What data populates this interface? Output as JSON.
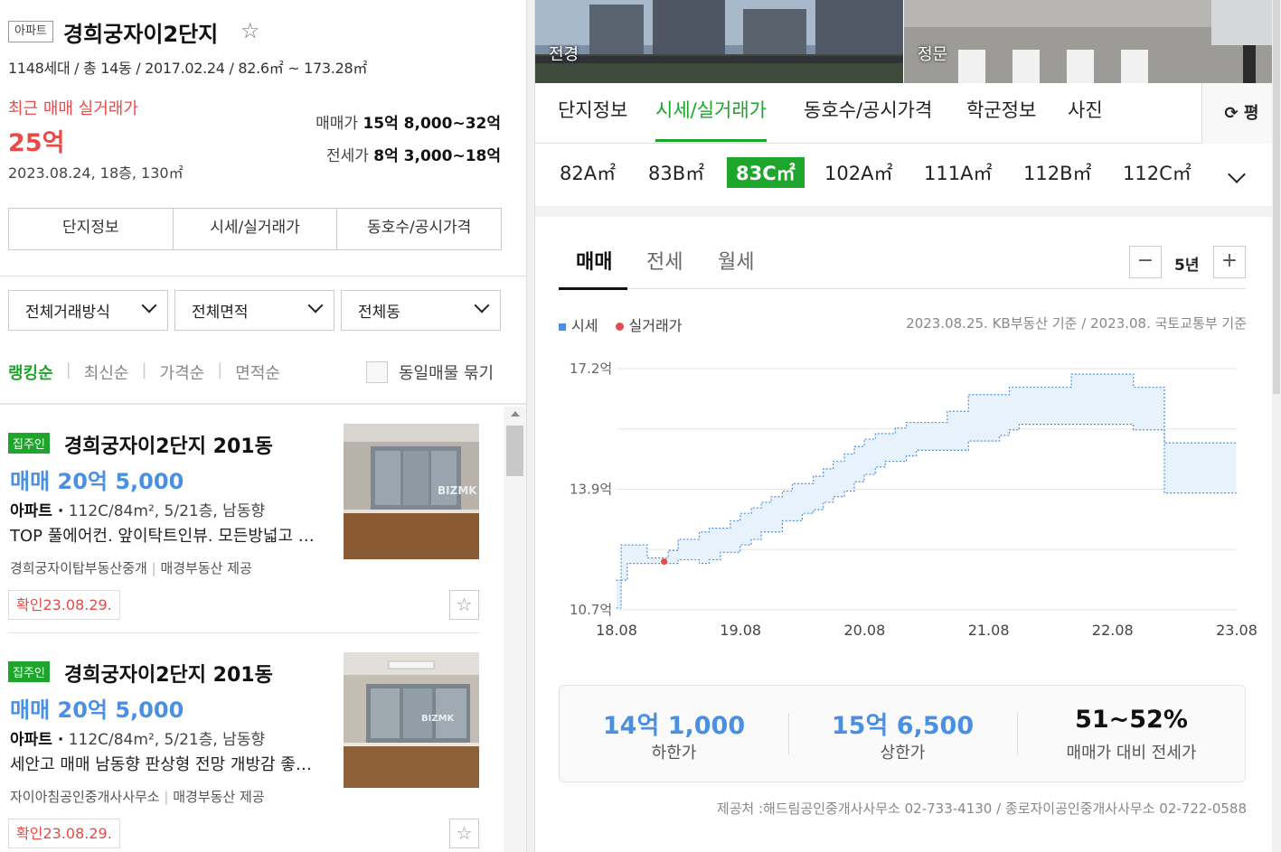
{
  "header": {
    "type_badge": "아파트",
    "complex_name": "경희궁자이2단지",
    "meta": "1148세대 / 총 14동 / 2017.02.24 / 82.6㎡ ~ 173.28㎡",
    "recent_label": "최근 매매 실거래가",
    "recent_price": "25억",
    "recent_detail": "2023.08.24, 18층, 130㎡",
    "sale_label": "매매가",
    "sale_range": "15억 8,000~32억",
    "jeonse_label": "전세가",
    "jeonse_range": "8억 3,000~18억"
  },
  "left_buttons": [
    "단지정보",
    "시세/실거래가",
    "동호수/공시가격"
  ],
  "filters": [
    "전체거래방식",
    "전체면적",
    "전체동"
  ],
  "sort": {
    "options": [
      "랭킹순",
      "최신순",
      "가격순",
      "면적순"
    ],
    "active": "랭킹순",
    "group_label": "동일매물 묶기"
  },
  "listings": [
    {
      "badge": "집주인",
      "title": "경희궁자이2단지 201동",
      "price": "매매 20억 5,000",
      "spec_type": "아파트 ·",
      "spec": " 112C/84m², 5/21층, 남동향",
      "desc": "TOP 풀에어컨. 앞이탁트인뷰. 모든방넓고 채광좋음",
      "agency": "경희궁자이탑부동산중개",
      "provider": "매경부동산 제공",
      "confirm": "확인23.08.29.",
      "watermark": "BIZMK"
    },
    {
      "badge": "집주인",
      "title": "경희궁자이2단지 201동",
      "price": "매매 20억 5,000",
      "spec_type": "아파트 ·",
      "spec": " 112C/84m², 5/21층, 남동향",
      "desc": "세안고 매매 남동향 판상형 전망 개방감 좋은 세대",
      "agency": "자이아침공인중개사사무소",
      "provider": "매경부동산 제공",
      "confirm": "확인23.08.29.",
      "watermark": "BIZMK"
    }
  ],
  "photos": [
    "전경",
    "정문"
  ],
  "tabs": [
    "단지정보",
    "시세/실거래가",
    "동호수/공시가격",
    "학군정보",
    "사진"
  ],
  "active_tab": "시세/실거래가",
  "unit_toggle": "평",
  "areas": [
    "82A㎡",
    "83B㎡",
    "83C㎡",
    "102A㎡",
    "111A㎡",
    "112B㎡",
    "112C㎡"
  ],
  "active_area": "83C㎡",
  "trade_tabs": [
    "매매",
    "전세",
    "월세"
  ],
  "active_trade": "매매",
  "period": "5년",
  "legend": {
    "market": "시세",
    "actual": "실거래가"
  },
  "basis": "2023.08.25. KB부동산 기준 / 2023.08. 국토교통부 기준",
  "colors": {
    "accent": "#1ea52b",
    "price_blue": "#4a90e2",
    "alert_red": "#e84a4a",
    "band_fill": "#e8f2fc"
  },
  "chart_data": {
    "type": "area",
    "y_ticks": [
      "17.2억",
      "13.9억",
      "10.7억"
    ],
    "ylim": [
      10.7,
      17.2
    ],
    "x_ticks": [
      "18.08",
      "19.08",
      "20.08",
      "21.08",
      "22.08",
      "23.08"
    ],
    "xlim": [
      2018.583,
      2023.583
    ],
    "grid": true,
    "series": [
      {
        "name": "시세",
        "x": [
          2018.58,
          2018.62,
          2018.67,
          2018.75,
          2018.83,
          2019.0,
          2019.08,
          2019.17,
          2019.25,
          2019.33,
          2019.42,
          2019.5,
          2019.58,
          2019.67,
          2019.75,
          2019.83,
          2019.92,
          2020.0,
          2020.08,
          2020.17,
          2020.25,
          2020.33,
          2020.42,
          2020.5,
          2020.58,
          2020.67,
          2020.75,
          2020.83,
          2020.92,
          2021.0,
          2021.08,
          2021.17,
          2021.25,
          2021.33,
          2021.42,
          2021.5,
          2021.58,
          2021.67,
          2021.75,
          2021.83,
          2021.92,
          2022.0,
          2022.08,
          2022.17,
          2022.25,
          2022.33,
          2022.42,
          2022.5,
          2022.58,
          2022.67,
          2022.75,
          2023.0,
          2023.25,
          2023.58
        ],
        "low": [
          10.75,
          11.5,
          11.95,
          11.95,
          11.95,
          11.95,
          12.05,
          12.05,
          11.95,
          12.05,
          12.25,
          12.25,
          12.45,
          12.6,
          12.8,
          12.8,
          13.1,
          13.1,
          13.3,
          13.4,
          13.6,
          13.75,
          13.9,
          14.15,
          14.35,
          14.55,
          14.7,
          14.7,
          14.85,
          15.0,
          15.0,
          15.0,
          15.0,
          15.0,
          15.25,
          15.25,
          15.25,
          15.4,
          15.55,
          15.7,
          15.7,
          15.7,
          15.7,
          15.7,
          15.7,
          15.7,
          15.7,
          15.7,
          15.7,
          15.7,
          15.55,
          13.85,
          13.85,
          13.85
        ],
        "high": [
          11.5,
          12.45,
          12.45,
          12.45,
          12.1,
          12.3,
          12.6,
          12.6,
          12.8,
          12.9,
          12.9,
          13.1,
          13.3,
          13.45,
          13.6,
          13.75,
          13.9,
          14.1,
          14.1,
          14.3,
          14.5,
          14.7,
          14.9,
          15.1,
          15.3,
          15.45,
          15.45,
          15.6,
          15.75,
          15.75,
          15.75,
          15.75,
          16.05,
          16.05,
          16.5,
          16.5,
          16.5,
          16.5,
          16.7,
          16.7,
          16.7,
          16.7,
          16.7,
          16.7,
          17.05,
          17.05,
          17.05,
          17.05,
          17.05,
          17.05,
          16.7,
          15.2,
          15.2,
          15.2
        ]
      },
      {
        "name": "실거래가",
        "points": [
          {
            "x": "2018.12",
            "y": 12.0
          }
        ]
      }
    ]
  },
  "summary": [
    {
      "value": "14억 1,000",
      "label": "하한가"
    },
    {
      "value": "15억 6,500",
      "label": "상한가"
    },
    {
      "value": "51~52%",
      "label": "매매가 대비 전세가"
    }
  ],
  "provider_line": "제공처 :해드림공인중개사사무소 02-733-4130 / 종로자이공인중개사사무소 02-722-0588"
}
